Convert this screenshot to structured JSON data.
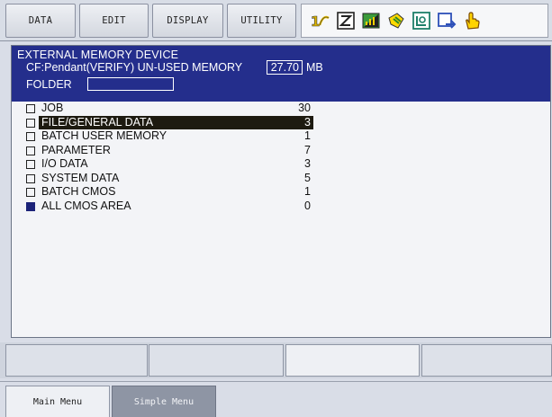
{
  "top_menu": {
    "data": "DATA",
    "edit": "EDIT",
    "display": "DISPLAY",
    "utility": "UTILITY"
  },
  "status_icons": [
    "robot-axis-icon",
    "edit-mode-icon",
    "speed-chart-icon",
    "tool-icon",
    "coordinate-icon",
    "cycle-icon",
    "servo-hand-icon"
  ],
  "header": {
    "title": "EXTERNAL MEMORY DEVICE",
    "device_text": "CF:Pendant(VERIFY) UN-USED MEMORY",
    "memory_value": "27.70",
    "memory_unit": "MB",
    "folder_label": "FOLDER",
    "folder_value": ""
  },
  "items": [
    {
      "label": "JOB",
      "count": "30",
      "checked": false,
      "selected": false
    },
    {
      "label": "FILE/GENERAL DATA",
      "count": "3",
      "checked": false,
      "selected": true
    },
    {
      "label": "BATCH USER MEMORY",
      "count": "1",
      "checked": false,
      "selected": false
    },
    {
      "label": "PARAMETER",
      "count": "7",
      "checked": false,
      "selected": false
    },
    {
      "label": "I/O DATA",
      "count": "3",
      "checked": false,
      "selected": false
    },
    {
      "label": "SYSTEM DATA",
      "count": "5",
      "checked": false,
      "selected": false
    },
    {
      "label": "BATCH CMOS",
      "count": "1",
      "checked": false,
      "selected": false
    },
    {
      "label": "ALL CMOS AREA",
      "count": "0",
      "checked": true,
      "selected": false
    }
  ],
  "bottom_tabs": {
    "main_menu": "Main Menu",
    "simple_menu": "Simple Menu"
  },
  "colors": {
    "header_bg": "#242e8c",
    "selection_bg": "#1d1a10",
    "checked_box": "#1b2278"
  }
}
